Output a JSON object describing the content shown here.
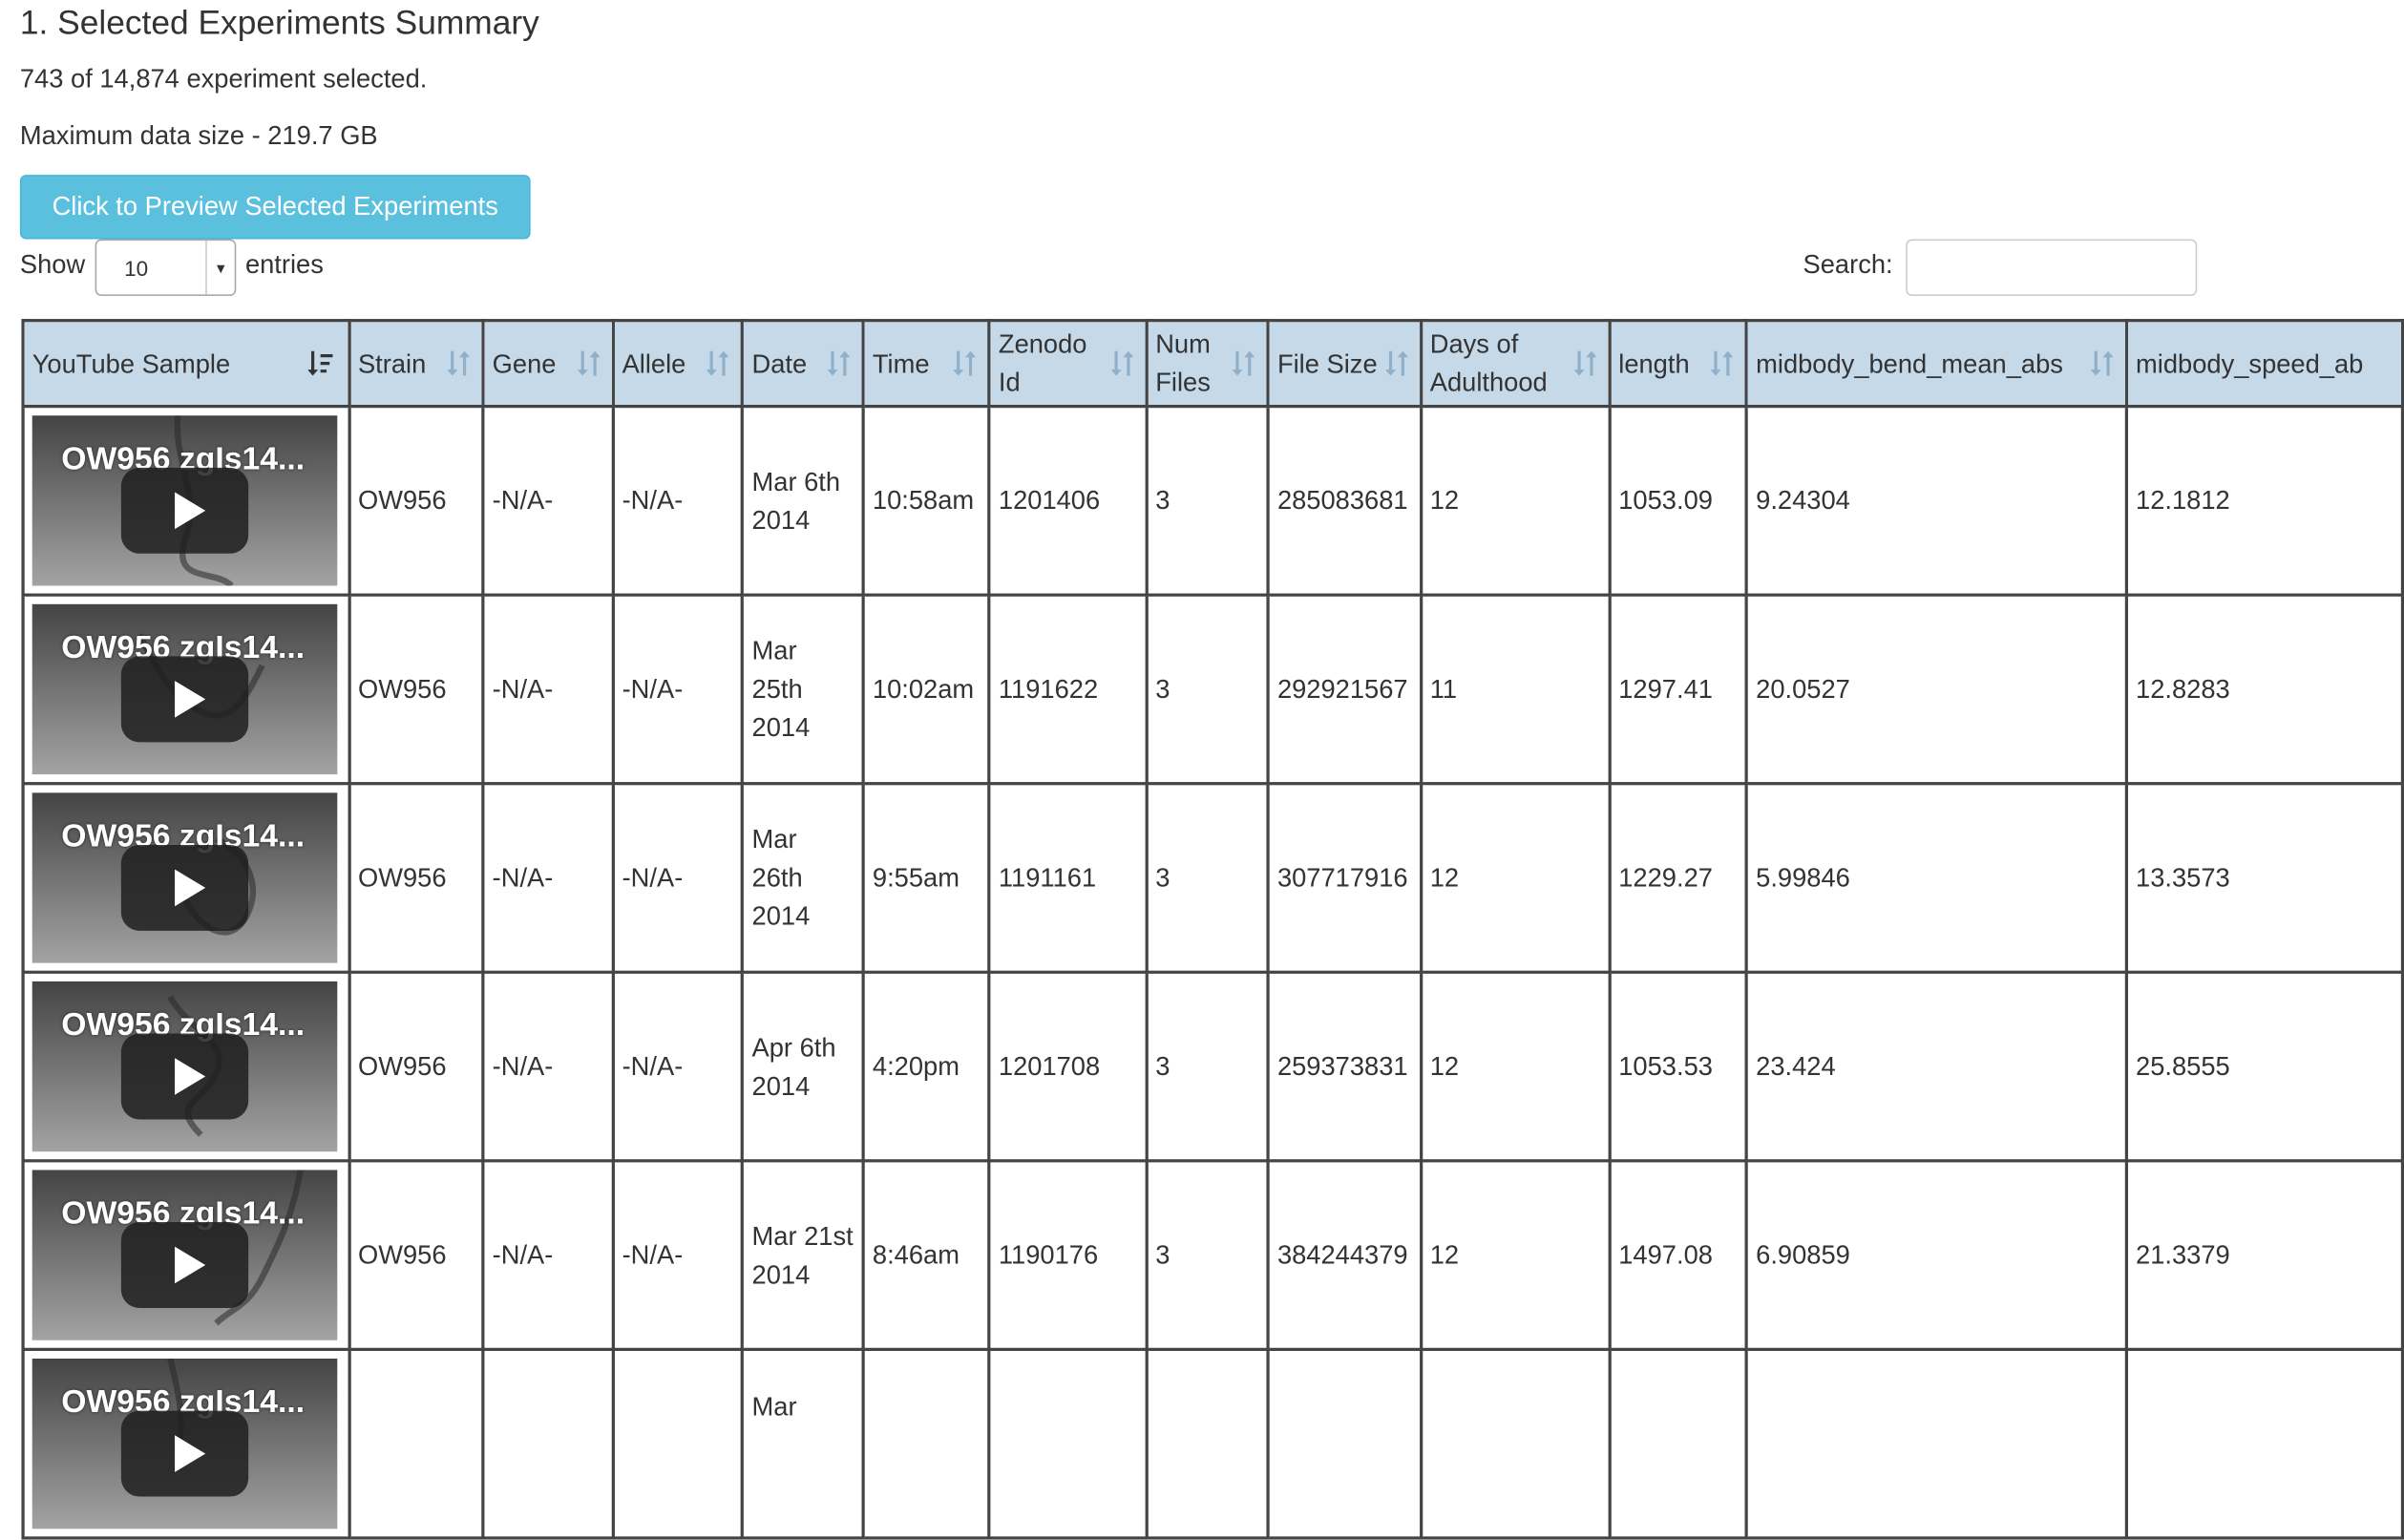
{
  "page": {
    "title": "1. Selected Experiments Summary",
    "selected_text": "743 of 14,874 experiment selected.",
    "max_size_text": "Maximum data size - 219.7 GB",
    "preview_button": "Click to Preview Selected Experiments"
  },
  "table_controls": {
    "show_label": "Show",
    "entries_value": "10",
    "entries_label": "entries",
    "search_label": "Search:",
    "search_value": ""
  },
  "columns": [
    "YouTube Sample",
    "Strain",
    "Gene",
    "Allele",
    "Date",
    "Time",
    "Zenodo Id",
    "Num Files",
    "File Size",
    "Days of Adulthood",
    "length",
    "midbody_bend_mean_abs",
    "midbody_speed_ab"
  ],
  "rows": [
    {
      "video": "OW956 zgIs14...",
      "strain": "OW956",
      "gene": "-N/A-",
      "allele": "-N/A-",
      "date": "Mar 6th 2014",
      "time": "10:58am",
      "zenodo": "1201406",
      "num_files": "3",
      "file_size": "285083681",
      "days": "12",
      "length": "1053.09",
      "bend": "9.24304",
      "speed": "12.1812"
    },
    {
      "video": "OW956 zgIs14...",
      "strain": "OW956",
      "gene": "-N/A-",
      "allele": "-N/A-",
      "date": "Mar 25th 2014",
      "time": "10:02am",
      "zenodo": "1191622",
      "num_files": "3",
      "file_size": "292921567",
      "days": "11",
      "length": "1297.41",
      "bend": "20.0527",
      "speed": "12.8283"
    },
    {
      "video": "OW956 zgIs14...",
      "strain": "OW956",
      "gene": "-N/A-",
      "allele": "-N/A-",
      "date": "Mar 26th 2014",
      "time": "9:55am",
      "zenodo": "1191161",
      "num_files": "3",
      "file_size": "307717916",
      "days": "12",
      "length": "1229.27",
      "bend": "5.99846",
      "speed": "13.3573"
    },
    {
      "video": "OW956 zgIs14...",
      "strain": "OW956",
      "gene": "-N/A-",
      "allele": "-N/A-",
      "date": "Apr 6th 2014",
      "time": "4:20pm",
      "zenodo": "1201708",
      "num_files": "3",
      "file_size": "259373831",
      "days": "12",
      "length": "1053.53",
      "bend": "23.424",
      "speed": "25.8555"
    },
    {
      "video": "OW956 zgIs14...",
      "strain": "OW956",
      "gene": "-N/A-",
      "allele": "-N/A-",
      "date": "Mar 21st 2014",
      "time": "8:46am",
      "zenodo": "1190176",
      "num_files": "3",
      "file_size": "384244379",
      "days": "12",
      "length": "1497.08",
      "bend": "6.90859",
      "speed": "21.3379"
    },
    {
      "video": "OW956 zgIs14...",
      "strain": "",
      "gene": "",
      "allele": "",
      "date": "Mar",
      "time": "",
      "zenodo": "",
      "num_files": "",
      "file_size": "",
      "days": "",
      "length": "",
      "bend": "",
      "speed": ""
    }
  ],
  "colors": {
    "header_bg": "#c6d9e8",
    "button_bg": "#5bc0de",
    "grid_border": "#444444"
  },
  "icons": {
    "sort_active": "sort-ascending-icon",
    "sort_inactive": "sort-both-icon",
    "play": "play-icon"
  }
}
